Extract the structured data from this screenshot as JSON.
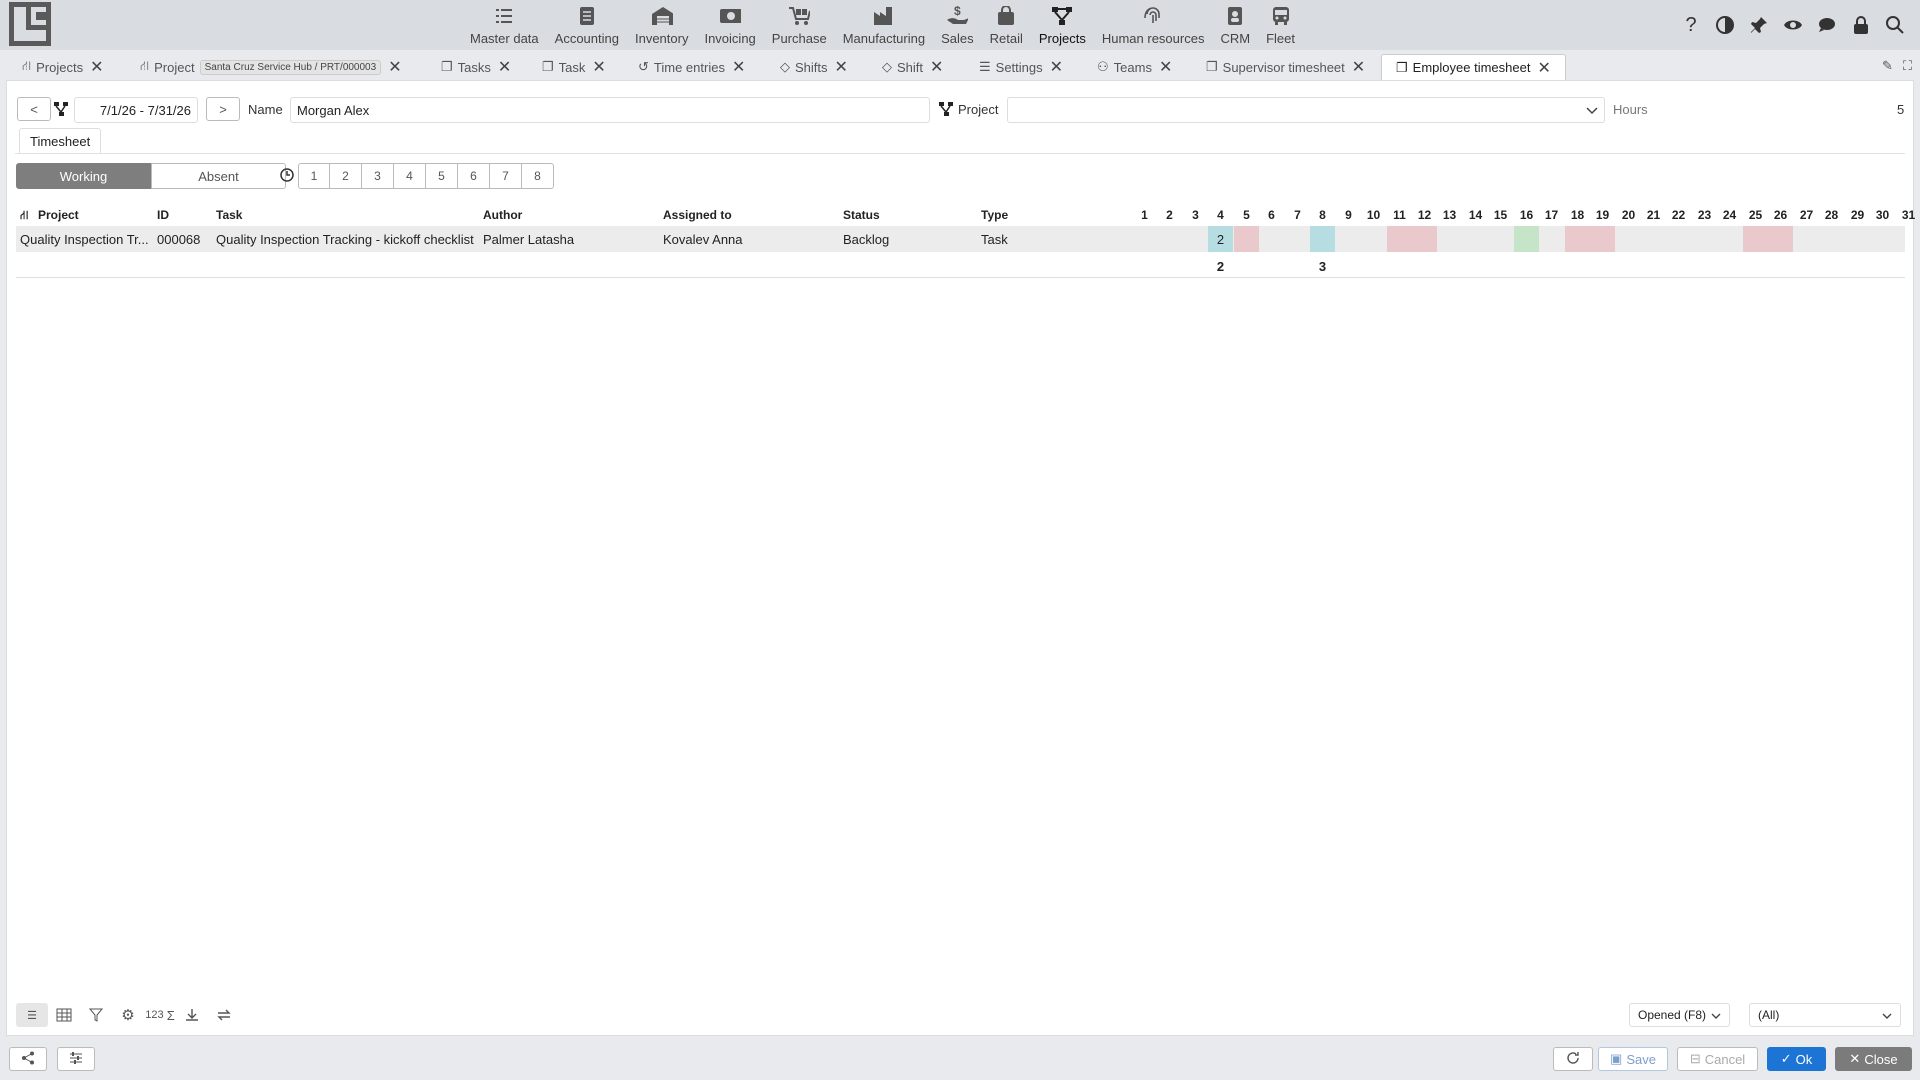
{
  "menu": {
    "items": [
      {
        "label": "Master data",
        "icon": "checklist-icon"
      },
      {
        "label": "Accounting",
        "icon": "ledger-icon"
      },
      {
        "label": "Inventory",
        "icon": "warehouse-icon"
      },
      {
        "label": "Invoicing",
        "icon": "cash-icon"
      },
      {
        "label": "Purchase",
        "icon": "cart-icon"
      },
      {
        "label": "Manufacturing",
        "icon": "factory-icon"
      },
      {
        "label": "Sales",
        "icon": "hand-coin-icon"
      },
      {
        "label": "Retail",
        "icon": "bag-icon"
      },
      {
        "label": "Projects",
        "icon": "project-tree-icon"
      },
      {
        "label": "Human resources",
        "icon": "fingerprint-icon"
      },
      {
        "label": "CRM",
        "icon": "contact-icon"
      },
      {
        "label": "Fleet",
        "icon": "bus-icon"
      }
    ],
    "active": "Projects"
  },
  "tabs": {
    "projects": "Projects",
    "project": "Project",
    "project_sub": "Santa Cruz Service Hub / PRT/000003",
    "tasks": "Tasks",
    "task": "Task",
    "time_entries": "Time entries",
    "shifts": "Shifts",
    "shift": "Shift",
    "settings": "Settings",
    "teams": "Teams",
    "supervisor": "Supervisor timesheet",
    "employee": "Employee timesheet"
  },
  "filter": {
    "prev": "<",
    "next": ">",
    "date_range": "7/1/26 - 7/31/26",
    "name_label": "Name",
    "name_value": "Morgan Alex",
    "project_label": "Project",
    "project_value": "",
    "hours_label": "Hours",
    "hours_value": "5"
  },
  "sheet_tab": "Timesheet",
  "mode": {
    "working": "Working",
    "absent": "Absent"
  },
  "hour_buttons": [
    "1",
    "2",
    "3",
    "4",
    "5",
    "6",
    "7",
    "8"
  ],
  "grid": {
    "headers": {
      "project": "Project",
      "id": "ID",
      "task": "Task",
      "author": "Author",
      "assigned": "Assigned to",
      "status": "Status",
      "type": "Type"
    },
    "days": [
      "1",
      "2",
      "3",
      "4",
      "5",
      "6",
      "7",
      "8",
      "9",
      "10",
      "11",
      "12",
      "13",
      "14",
      "15",
      "16",
      "17",
      "18",
      "19",
      "20",
      "21",
      "22",
      "23",
      "24",
      "25",
      "26",
      "27",
      "28",
      "29",
      "30",
      "31"
    ],
    "row": {
      "project": "Quality Inspection Tr...",
      "id": "000068",
      "task": "Quality Inspection Tracking - kickoff checklist",
      "author": "Palmer Latasha",
      "assigned": "Kovalev Anna",
      "status": "Backlog",
      "type": "Task",
      "day_values": {
        "4": "2"
      }
    },
    "cell_colors": {
      "4": "blue",
      "5": "red",
      "8": "blue",
      "11": "red",
      "12": "red",
      "16": "green",
      "18": "red",
      "19": "red",
      "25": "red",
      "26": "red"
    },
    "totals": {
      "4": "2",
      "8": "3"
    }
  },
  "grid_tools": {
    "numbers_label": "123",
    "sum_label": "Σ"
  },
  "bottom_filters": {
    "state": "Opened (F8)",
    "scope": "(All)"
  },
  "footer": {
    "save": "Save",
    "cancel": "Cancel",
    "ok": "Ok",
    "close": "Close"
  }
}
